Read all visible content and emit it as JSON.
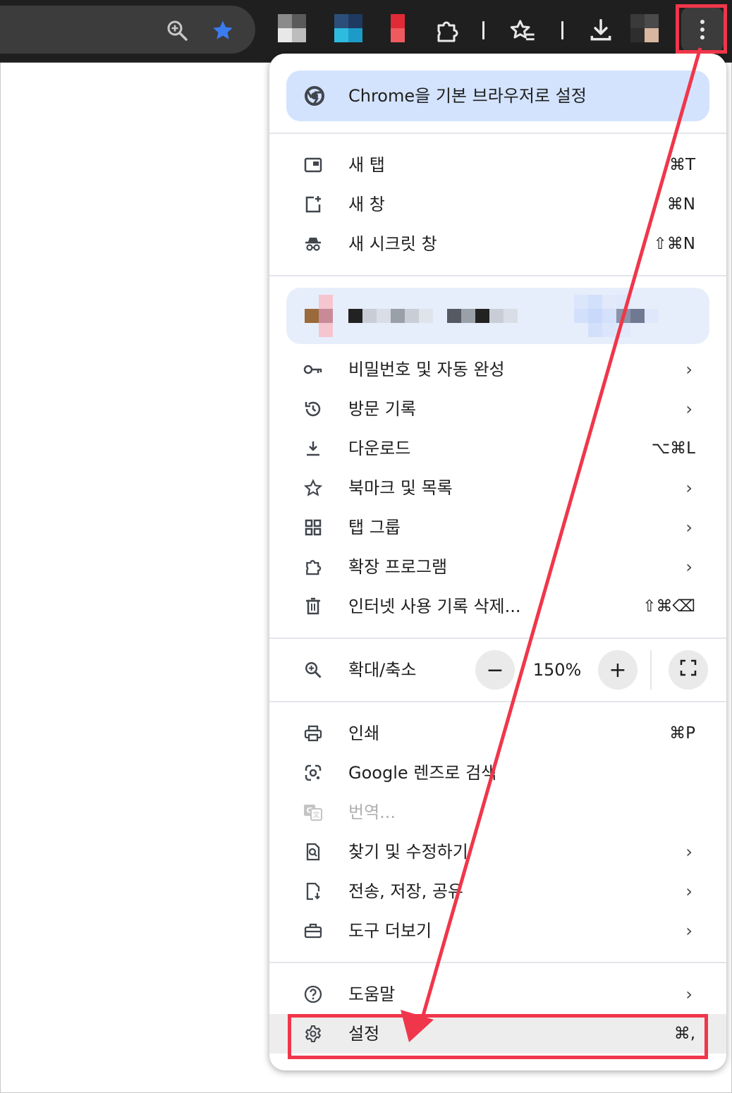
{
  "toolbar": {
    "zoom_icon": "zoom-in-icon",
    "bookmark_icon": "star-filled-icon",
    "extensions_icon": "puzzle-icon",
    "reading_list_icon": "star-list-icon",
    "downloads_icon": "download-icon",
    "menu_icon": "three-dots-vertical-icon"
  },
  "menu": {
    "default_browser": "Chrome을 기본 브라우저로 설정",
    "new_tab": {
      "label": "새 탭",
      "shortcut": "⌘T"
    },
    "new_window": {
      "label": "새 창",
      "shortcut": "⌘N"
    },
    "incognito": {
      "label": "새 시크릿 창",
      "shortcut": "⇧⌘N"
    },
    "passwords": {
      "label": "비밀번호 및 자동 완성",
      "chevron": "›"
    },
    "history": {
      "label": "방문 기록",
      "chevron": "›"
    },
    "downloads": {
      "label": "다운로드",
      "shortcut": "⌥⌘L"
    },
    "bookmarks": {
      "label": "북마크 및 목록",
      "chevron": "›"
    },
    "tab_groups": {
      "label": "탭 그룹",
      "chevron": "›"
    },
    "extensions": {
      "label": "확장 프로그램",
      "chevron": "›"
    },
    "clear_data": {
      "label": "인터넷 사용 기록 삭제...",
      "shortcut": "⇧⌘⌫"
    },
    "zoom": {
      "label": "확대/축소",
      "minus": "−",
      "value": "150%",
      "plus": "+"
    },
    "print": {
      "label": "인쇄",
      "shortcut": "⌘P"
    },
    "lens": {
      "label": "Google 렌즈로 검색"
    },
    "translate": {
      "label": "번역..."
    },
    "find": {
      "label": "찾기 및 수정하기",
      "chevron": "›"
    },
    "cast": {
      "label": "전송, 저장, 공유",
      "chevron": "›"
    },
    "more_tools": {
      "label": "도구 더보기",
      "chevron": "›"
    },
    "help": {
      "label": "도움말",
      "chevron": "›"
    },
    "settings": {
      "label": "설정",
      "shortcut": "⌘,"
    }
  },
  "colors": {
    "highlight": "#f0364b",
    "accent_pill": "#d3e3fd",
    "profile_pill": "#e7eefb",
    "toolbar_bg": "#1f1f1f"
  }
}
